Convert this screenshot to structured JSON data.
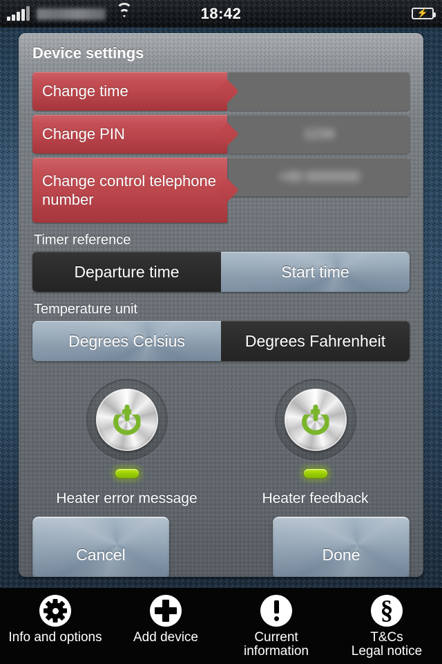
{
  "status_bar": {
    "carrier": "",
    "time": "18:42",
    "signal_icon": "signal-bars-icon",
    "wifi_icon": "wifi-icon",
    "battery_icon": "battery-charging-icon"
  },
  "panel": {
    "title": "Device settings",
    "settings_rows": [
      {
        "label": "Change time",
        "value": ""
      },
      {
        "label": "Change PIN",
        "value": "1234"
      },
      {
        "label": "Change control telephone number",
        "value": "+00 0000000"
      }
    ],
    "timer_reference": {
      "label": "Timer reference",
      "options": [
        "Departure time",
        "Start time"
      ],
      "selected": "Departure time"
    },
    "temperature_unit": {
      "label": "Temperature unit",
      "options": [
        "Degrees Celsius",
        "Degrees Fahrenheit"
      ],
      "selected": "Degrees Fahrenheit"
    },
    "toggles": [
      {
        "caption": "Heater error message",
        "state": "on",
        "icon": "power-icon",
        "led": "led-green"
      },
      {
        "caption": "Heater feedback",
        "state": "on",
        "icon": "power-icon",
        "led": "led-green"
      }
    ],
    "actions": {
      "cancel_label": "Cancel",
      "done_label": "Done"
    }
  },
  "tabbar": {
    "items": [
      {
        "label": "Info and options",
        "icon": "gear-icon"
      },
      {
        "label": "Add device",
        "icon": "plus-icon"
      },
      {
        "label": "Current\ninformation",
        "icon": "exclamation-icon"
      },
      {
        "label": "T&Cs\nLegal notice",
        "icon": "section-sign-icon"
      }
    ]
  },
  "colors": {
    "accent_red": "#bb464c",
    "selected_dark": "#2c2c2c",
    "metal_blue": "#8296a8",
    "led_green": "#9ed106",
    "power_green": "#7ab52c",
    "panel_gray": "#6e7479",
    "value_field_gray": "#6b6b6b"
  }
}
